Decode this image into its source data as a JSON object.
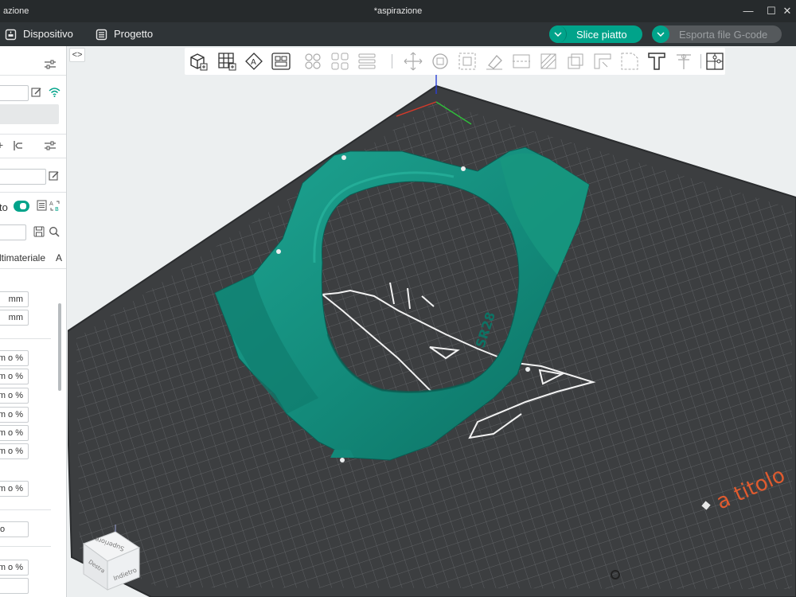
{
  "window": {
    "left_title": "azione",
    "center_title": "*aspirazione",
    "controls": [
      "—",
      "☐",
      "✕"
    ]
  },
  "menubar": {
    "device_label": "Dispositivo",
    "project_label": "Progetto",
    "slice_label": "Slice piatto",
    "export_label": "Esporta file G-code"
  },
  "left_panel": {
    "plate_label": "to",
    "tabs_label": "ltimateriale",
    "tab_a": "A",
    "units": [
      "mm",
      "mm"
    ],
    "percent_fields": [
      "m o %",
      "m o %",
      "m o %",
      "m o %",
      "m o %",
      "m o %",
      "m o %"
    ],
    "small_value": "o",
    "bottom_fields": [
      "m o %",
      ""
    ],
    "colors": {
      "accent": "#00a38a"
    }
  },
  "viewport": {
    "plate_brand_text": "a titolo",
    "model_emboss": "SR28",
    "model_color": "#13897a",
    "plate_color": "#3c3e40",
    "nav_cube": {
      "top": "Superiore",
      "front": "Indietro",
      "left": "Destra"
    }
  }
}
